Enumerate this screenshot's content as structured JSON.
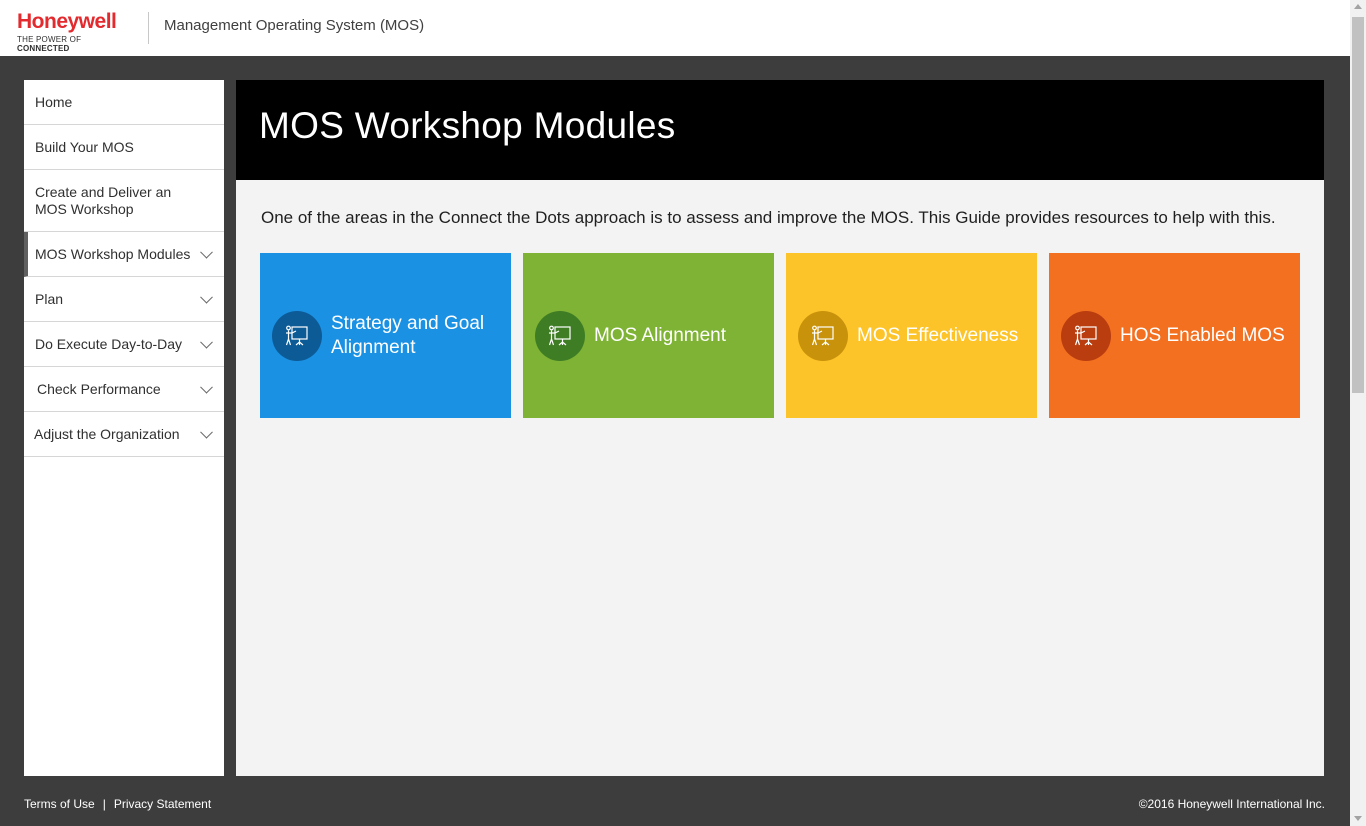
{
  "header": {
    "logo_name": "Honeywell",
    "logo_tagline_prefix": "THE POWER OF",
    "logo_tagline_bold": "CONNECTED",
    "app_title": "Management Operating System (MOS)"
  },
  "sidebar": {
    "items": [
      {
        "label": "Home",
        "expandable": false,
        "active": false
      },
      {
        "label": "Build Your MOS",
        "expandable": false,
        "active": false
      },
      {
        "label": "Create and Deliver an MOS Workshop",
        "expandable": false,
        "active": false
      },
      {
        "label": "MOS Workshop Modules",
        "expandable": true,
        "active": true
      },
      {
        "label": "Plan",
        "expandable": true,
        "active": false
      },
      {
        "label": "Do Execute Day-to-Day",
        "expandable": true,
        "active": false
      },
      {
        "label": "Check Performance",
        "expandable": true,
        "active": false
      },
      {
        "label": "Adjust the Organization",
        "expandable": true,
        "active": false
      }
    ]
  },
  "main": {
    "title": "MOS Workshop Modules",
    "intro": "One of the areas in the Connect the Dots approach is to assess and improve the MOS. This Guide provides resources to help with this.",
    "tiles": [
      {
        "label": "Strategy and Goal Alignment",
        "icon": "presenter-icon",
        "color": "#1a91e3",
        "circle_color": "#0c5a96"
      },
      {
        "label": "MOS Alignment",
        "icon": "presenter-icon",
        "color": "#7fb335",
        "circle_color": "#3f7d25"
      },
      {
        "label": "MOS Effectiveness",
        "icon": "presenter-icon",
        "color": "#fdc42a",
        "circle_color": "#c8920a"
      },
      {
        "label": "HOS Enabled MOS",
        "icon": "presenter-icon",
        "color": "#f37020",
        "circle_color": "#b93d0f"
      }
    ]
  },
  "footer": {
    "terms": "Terms of Use",
    "separator": "|",
    "privacy": "Privacy Statement",
    "copyright": "©2016 Honeywell International Inc."
  },
  "colors": {
    "brand_red": "#e32a2e",
    "page_bg": "#3d3d3d",
    "banner_bg": "#000000"
  }
}
